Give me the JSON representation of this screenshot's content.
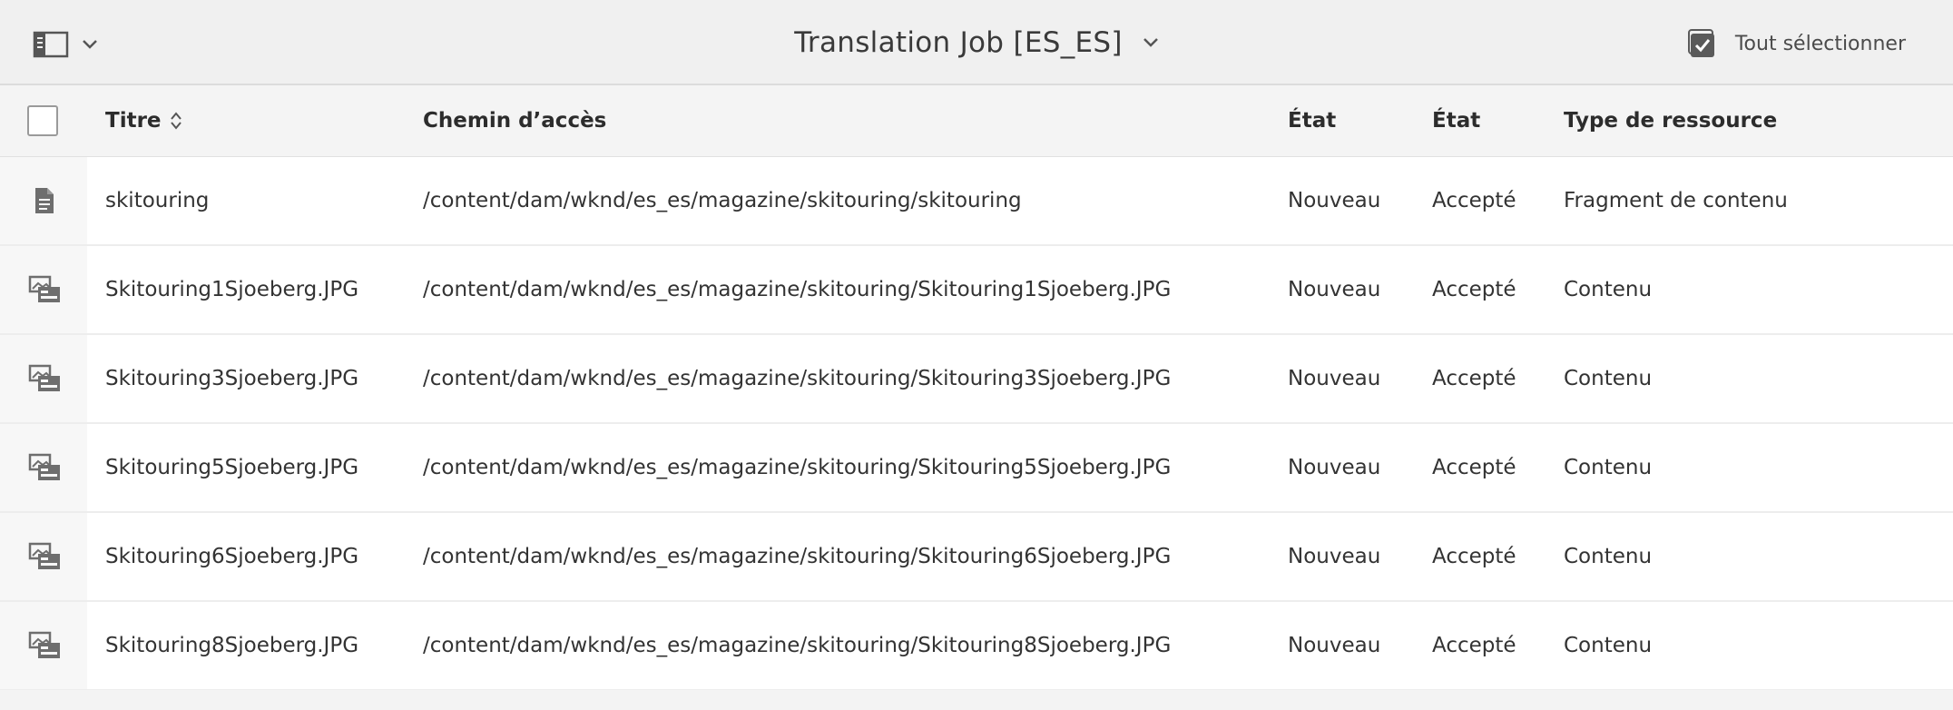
{
  "topbar": {
    "title": "Translation Job [ES_ES]",
    "select_all_label": "Tout sélectionner",
    "icons": {
      "rail_toggle": "sidebar-panel-icon",
      "rail_caret": "chevron-down-icon",
      "title_caret": "chevron-down-icon",
      "select_all": "checkbox-checked-icon"
    }
  },
  "table": {
    "headers": {
      "title": "Titre",
      "path": "Chemin d’accès",
      "status": "État",
      "state": "État",
      "type": "Type de ressource"
    },
    "rows": [
      {
        "icon": "document-icon",
        "title": "skitouring",
        "path": "/content/dam/wknd/es_es/magazine/skitouring/skitouring",
        "status": "Nouveau",
        "state": "Accepté",
        "type": "Fragment de contenu"
      },
      {
        "icon": "image-asset-icon",
        "title": "Skitouring1Sjoeberg.JPG",
        "path": "/content/dam/wknd/es_es/magazine/skitouring/Skitouring1Sjoeberg.JPG",
        "status": "Nouveau",
        "state": "Accepté",
        "type": "Contenu"
      },
      {
        "icon": "image-asset-icon",
        "title": "Skitouring3Sjoeberg.JPG",
        "path": "/content/dam/wknd/es_es/magazine/skitouring/Skitouring3Sjoeberg.JPG",
        "status": "Nouveau",
        "state": "Accepté",
        "type": "Contenu"
      },
      {
        "icon": "image-asset-icon",
        "title": "Skitouring5Sjoeberg.JPG",
        "path": "/content/dam/wknd/es_es/magazine/skitouring/Skitouring5Sjoeberg.JPG",
        "status": "Nouveau",
        "state": "Accepté",
        "type": "Contenu"
      },
      {
        "icon": "image-asset-icon",
        "title": "Skitouring6Sjoeberg.JPG",
        "path": "/content/dam/wknd/es_es/magazine/skitouring/Skitouring6Sjoeberg.JPG",
        "status": "Nouveau",
        "state": "Accepté",
        "type": "Contenu"
      },
      {
        "icon": "image-asset-icon",
        "title": "Skitouring8Sjoeberg.JPG",
        "path": "/content/dam/wknd/es_es/magazine/skitouring/Skitouring8Sjoeberg.JPG",
        "status": "Nouveau",
        "state": "Accepté",
        "type": "Contenu"
      }
    ]
  },
  "colors": {
    "topbar_bg": "#f0f0f0",
    "row_bg": "#ffffff",
    "text": "#2c2c2c",
    "icon": "#6e6e6e"
  }
}
